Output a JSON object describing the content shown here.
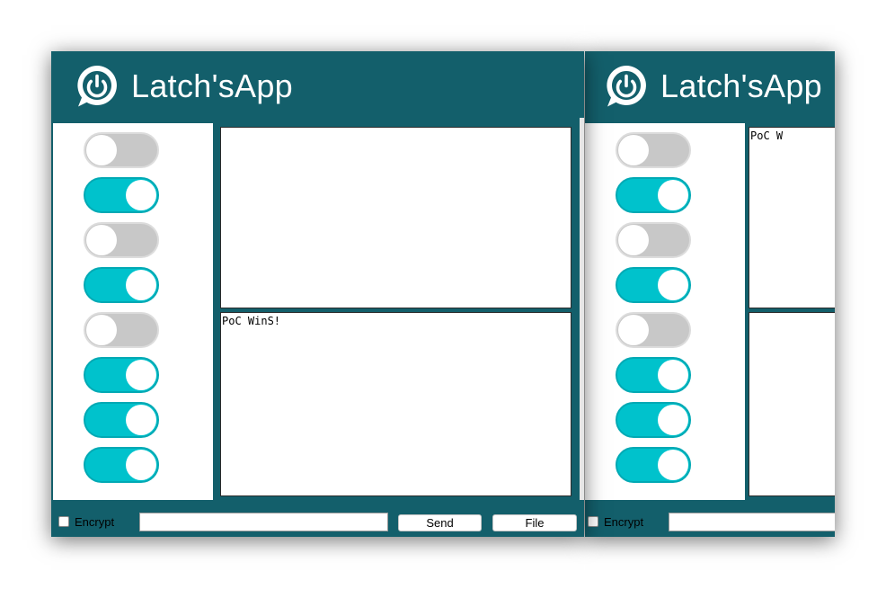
{
  "brand_colors": {
    "header_bg": "#135f6b",
    "toggle_on": "#00c2cc",
    "toggle_off": "#c8c8c8"
  },
  "windows": [
    {
      "title": "Latch'sApp",
      "logo_icon": "power-chat-bubble-icon",
      "toggles": [
        false,
        true,
        false,
        true,
        false,
        true,
        true,
        true
      ],
      "received_text": "",
      "message_text": "PoC WinS!",
      "encrypt_label": "Encrypt",
      "encrypt_checked": false,
      "input_value": "",
      "send_label": "Send",
      "file_label": "File"
    },
    {
      "title": "Latch'sApp",
      "logo_icon": "power-chat-bubble-icon",
      "toggles": [
        false,
        true,
        false,
        true,
        false,
        true,
        true,
        true
      ],
      "received_text": "PoC W",
      "message_text": "",
      "encrypt_label": "Encrypt",
      "encrypt_checked": false,
      "input_value": ""
    }
  ]
}
